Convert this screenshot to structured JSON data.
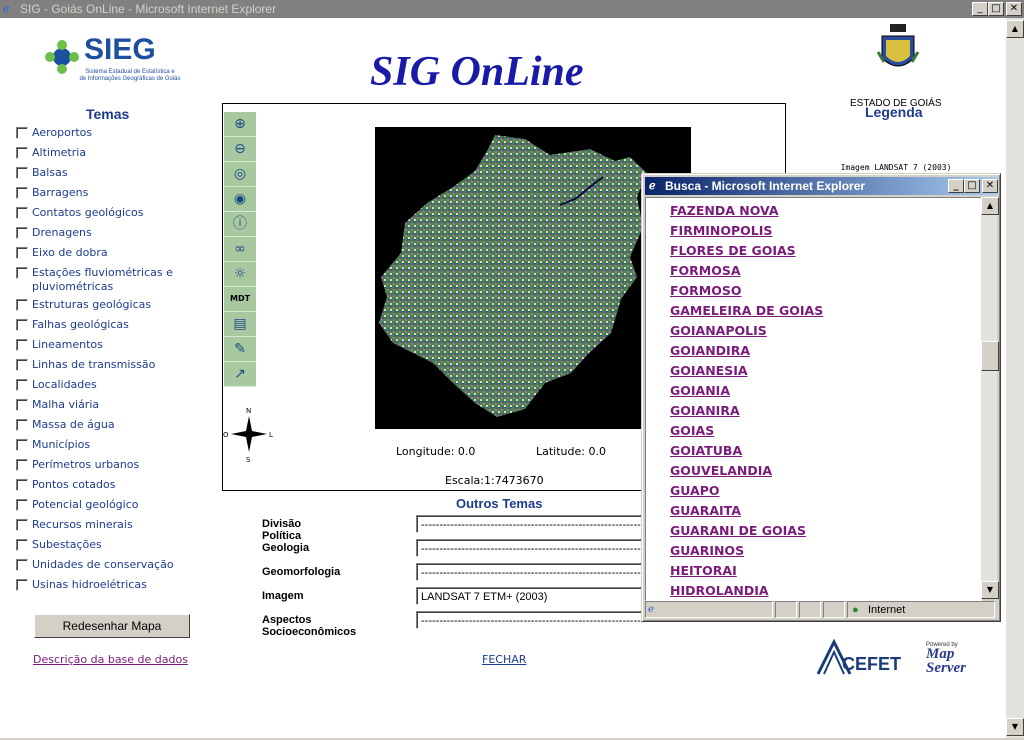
{
  "window": {
    "title": "SIG - Goiás OnLine - Microsoft Internet Explorer",
    "buttons": {
      "minimize": "_",
      "maximize": "□",
      "close": "✕"
    }
  },
  "header": {
    "logo_name": "SIEG",
    "logo_subtitle_1": "Sistema Estadual de Estatística e",
    "logo_subtitle_2": "de Informações Geográficas de Goiás",
    "app_title": "SIG OnLine",
    "state_label": "ESTADO DE GOIÁS"
  },
  "themes": {
    "heading": "Temas",
    "items": [
      "Aeroportos",
      "Altimetria",
      "Balsas",
      "Barragens",
      "Contatos geológicos",
      "Drenagens",
      "Eixo de dobra",
      "Estações fluviométricas e pluviométricas",
      "Estruturas geológicas",
      "Falhas geológicas",
      "Lineamentos",
      "Linhas de transmissão",
      "Localidades",
      "Malha viária",
      "Massa de água",
      "Municípios",
      "Perímetros urbanos",
      "Pontos cotados",
      "Potencial geológico",
      "Recursos minerais",
      "Subestações",
      "Unidades de conservação",
      "Usinas hidroelétricas"
    ],
    "redraw_button": "Redesenhar Mapa",
    "db_link": "Descrição da base de dados"
  },
  "map": {
    "tools": [
      "zoom-in",
      "zoom-out",
      "center",
      "globe",
      "info",
      "binoculars",
      "layers",
      "MDT",
      "print",
      "pen",
      "measure"
    ],
    "mdt_label": "MDT",
    "compass": {
      "n": "N",
      "s": "S",
      "o": "O",
      "l": "L"
    },
    "longitude_label": "Longitude:",
    "longitude_value": "0.0",
    "latitude_label": "Latitude:",
    "latitude_value": "0.0",
    "scale_label": "Escala:",
    "scale_value": "1:7473670"
  },
  "legend": {
    "heading": "Legenda",
    "item": "Imagem LANDSAT 7 (2003)"
  },
  "other_themes": {
    "heading": "Outros Temas",
    "rows": [
      {
        "label": "Divisão Política",
        "value": "---------------------------------------------------------------------"
      },
      {
        "label": "Geologia",
        "value": "---------------------------------------------------------------------"
      },
      {
        "label": "Geomorfologia",
        "value": "---------------------------------------------------------------------"
      },
      {
        "label": "Imagem",
        "value": "LANDSAT 7 ETM+ (2003)"
      },
      {
        "label": "Aspectos Socioeconômicos",
        "value": "---------------------------------------------------------------------"
      }
    ],
    "close_link": "FECHAR"
  },
  "footer": {
    "cefet_logo": "CEFET",
    "mapserver_powered": "Powered by",
    "mapserver_logo_1": "Map",
    "mapserver_logo_2": "Server"
  },
  "popup": {
    "title": "Busca - Microsoft Internet Explorer",
    "cities": [
      "FAZENDA NOVA",
      "FIRMINOPOLIS",
      "FLORES DE GOIAS",
      "FORMOSA",
      "FORMOSO",
      "GAMELEIRA DE GOIAS",
      "GOIANAPOLIS",
      "GOIANDIRA",
      "GOIANESIA",
      "GOIANIA",
      "GOIANIRA",
      "GOIAS",
      "GOIATUBA",
      "GOUVELANDIA",
      "GUAPO",
      "GUARAITA",
      "GUARANI DE GOIAS",
      "GUARINOS",
      "HEITORAI",
      "HIDROLANDIA"
    ],
    "status_zone": "Internet"
  }
}
